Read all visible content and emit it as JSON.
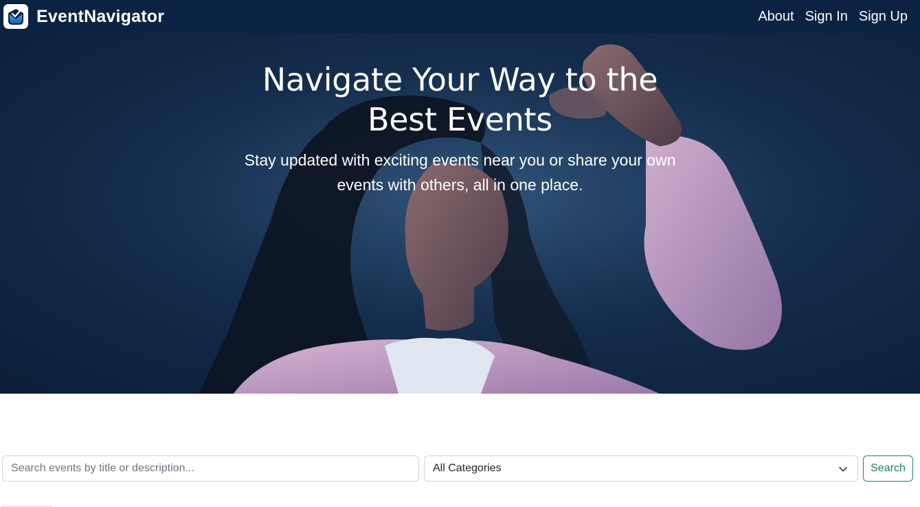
{
  "navbar": {
    "brand": "EventNavigator",
    "logo_icon": "envelope-check-icon",
    "links": [
      {
        "label": "About"
      },
      {
        "label": "Sign In"
      },
      {
        "label": "Sign Up"
      }
    ],
    "background": "#0b2342"
  },
  "hero": {
    "title": "Navigate Your Way to the Best Events",
    "subtitle": "Stay updated with exciting events near you or share your own events with others, all in one place.",
    "background": "#142c4d"
  },
  "search": {
    "placeholder": "Search events by title or description...",
    "value": "",
    "category_selected": "All Categories",
    "button_label": "Search",
    "accent": "#198754"
  }
}
